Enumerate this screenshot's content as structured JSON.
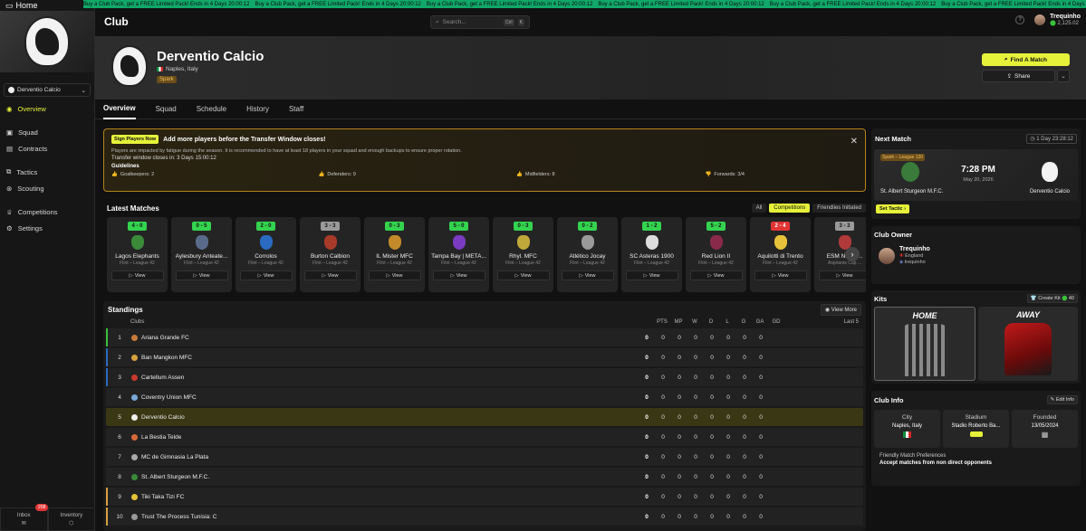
{
  "sidebar": {
    "home_label": "Home",
    "club_name": "Derventio Calcio",
    "items": [
      {
        "label": "Overview",
        "icon": "eye-icon"
      },
      {
        "label": "Squad",
        "icon": "briefcase-icon"
      },
      {
        "label": "Contracts",
        "icon": "document-icon"
      },
      {
        "label": "Tactics",
        "icon": "tactics-icon"
      },
      {
        "label": "Scouting",
        "icon": "binoculars-icon"
      },
      {
        "label": "Competitions",
        "icon": "trophy-icon"
      },
      {
        "label": "Settings",
        "icon": "gear-icon"
      }
    ],
    "inbox_label": "Inbox",
    "inbox_count": "208",
    "inventory_label": "Inventory"
  },
  "ticker": {
    "text": "Buy a Club Pack, get a FREE Limited Pack! Ends in 4 Days 20:00:12"
  },
  "header": {
    "title": "Club",
    "search_placeholder": "Search...",
    "kbd1": "Ctrl",
    "kbd2": "K",
    "user_name": "Trequinho",
    "user_coins": "2,125.02"
  },
  "club": {
    "name": "Derventio Calcio",
    "location": "Naples, Italy",
    "tier": "Spark",
    "find_match": "Find A Match",
    "share": "Share"
  },
  "tabs": [
    "Overview",
    "Squad",
    "Schedule",
    "History",
    "Staff"
  ],
  "alert": {
    "button": "Sign Players Now",
    "title": "Add more players before the Transfer Window closes!",
    "text": "Players are impacted by fatigue during the season. It is recommended to have at least 18 players in your squad and enough backups to ensure proper rotation.",
    "window": "Transfer window closes in: 3 Days 15:00:12",
    "guidelines_label": "Guidelines",
    "guidelines": [
      "Goalkeepers: 2",
      "Defenders: 9",
      "Midfielders: 8",
      "Forwards: 3/4"
    ]
  },
  "latest_matches": {
    "title": "Latest Matches",
    "filters": [
      "All",
      "Competitions",
      "Friendlies Initiated"
    ],
    "view_label": "View",
    "items": [
      {
        "score": "4 - 0",
        "result": "w",
        "opponent": "Lagos Elephants",
        "league": "Flint – League 42",
        "color": "#3a8a3a"
      },
      {
        "score": "0 - 5",
        "result": "w",
        "opponent": "Aylesbury Anteate...",
        "league": "Flint – League 42",
        "color": "#5a6a8a"
      },
      {
        "score": "2 - 0",
        "result": "w",
        "opponent": "Corrolos",
        "league": "Flint – League 42",
        "color": "#2a6ac1"
      },
      {
        "score": "3 - 3",
        "result": "d",
        "opponent": "Burton Calbion",
        "league": "Flint – League 42",
        "color": "#a83a2a"
      },
      {
        "score": "0 - 3",
        "result": "w",
        "opponent": "IL Mister MFC",
        "league": "Flint – League 42",
        "color": "#c28a2a"
      },
      {
        "score": "5 - 0",
        "result": "w",
        "opponent": "Tampa Bay | META...",
        "league": "Flint – League 42",
        "color": "#7a3ac1"
      },
      {
        "score": "0 - 3",
        "result": "w",
        "opponent": "Rhyl. MFC",
        "league": "Flint – League 42",
        "color": "#c1a83a"
      },
      {
        "score": "0 - 2",
        "result": "w",
        "opponent": "Atlético Jocay",
        "league": "Flint – League 42",
        "color": "#9a9a9a"
      },
      {
        "score": "1 - 2",
        "result": "w",
        "opponent": "SC Asteras 1900",
        "league": "Flint – League 42",
        "color": "#ddd"
      },
      {
        "score": "5 - 2",
        "result": "w",
        "opponent": "Red Lion II",
        "league": "Flint – League 42",
        "color": "#8a2a4a"
      },
      {
        "score": "2 - 4",
        "result": "l",
        "opponent": "Aquilotti di Trento",
        "league": "Flint – League 42",
        "color": "#e6c23a"
      },
      {
        "score": "3 - 3",
        "result": "d",
        "opponent": "ESM Novi P...",
        "league": "Aspirants Cup ...",
        "color": "#b03a3a"
      }
    ]
  },
  "standings": {
    "title": "Standings",
    "view_more": "View More",
    "col_clubs": "Clubs",
    "cols": [
      "PTS",
      "MP",
      "W",
      "D",
      "L",
      "G",
      "GA",
      "GD"
    ],
    "last5": "Last 5",
    "rows": [
      {
        "rank": "1",
        "club": "Ariana Grande FC",
        "bar": "#3ac13a",
        "ico": "#c87a3a"
      },
      {
        "rank": "2",
        "club": "Ban Mangkon MFC",
        "bar": "#2a6ac1",
        "ico": "#d8a040"
      },
      {
        "rank": "3",
        "club": "Cartellum Assen",
        "bar": "#2a6ac1",
        "ico": "#c83a2a"
      },
      {
        "rank": "4",
        "club": "Coventry Union MFC",
        "bar": "",
        "ico": "#7aa8d8"
      },
      {
        "rank": "5",
        "club": "Derventio Calcio",
        "bar": "",
        "ico": "#eeeeee",
        "highlight": true
      },
      {
        "rank": "6",
        "club": "La Bestia Telde",
        "bar": "",
        "ico": "#d86a3a"
      },
      {
        "rank": "7",
        "club": "MC de Gimnasia La Plata",
        "bar": "",
        "ico": "#aaaaaa"
      },
      {
        "rank": "8",
        "club": "St. Albert Sturgeon M.F.C.",
        "bar": "",
        "ico": "#3a8a3a"
      },
      {
        "rank": "9",
        "club": "Tiki Taka Tizi FC",
        "bar": "#d8a040",
        "ico": "#e6c23a"
      },
      {
        "rank": "10",
        "club": "Trust The Process Tunisia: C",
        "bar": "#d8a040",
        "ico": "#9a9a9a"
      }
    ],
    "zero": "0"
  },
  "next_match": {
    "title": "Next Match",
    "timer": "1 Day 23:28:12",
    "league": "Spark – League 130",
    "time": "7:28 PM",
    "date": "May 20, 2026",
    "home": "St. Albert Sturgeon M.F.C.",
    "away": "Derventio Calcio",
    "set_tactic": "Set Tactic"
  },
  "club_owner": {
    "title": "Club Owner",
    "name": "Trequinho",
    "country": "England",
    "handle": "trequinho"
  },
  "kits": {
    "title": "Kits",
    "create_kit": "Create Kit",
    "create_cost": "40",
    "home": "HOME",
    "away": "AWAY"
  },
  "club_info": {
    "title": "Club Info",
    "edit": "Edit Info",
    "city_label": "City",
    "city": "Naples, Italy",
    "stadium_label": "Stadium",
    "stadium": "Stadio Roberto Ba...",
    "founded_label": "Founded",
    "founded": "13/05/2024",
    "pref_label": "Friendly Match Preferences",
    "pref_value": "Accept matches from non direct opponents"
  }
}
